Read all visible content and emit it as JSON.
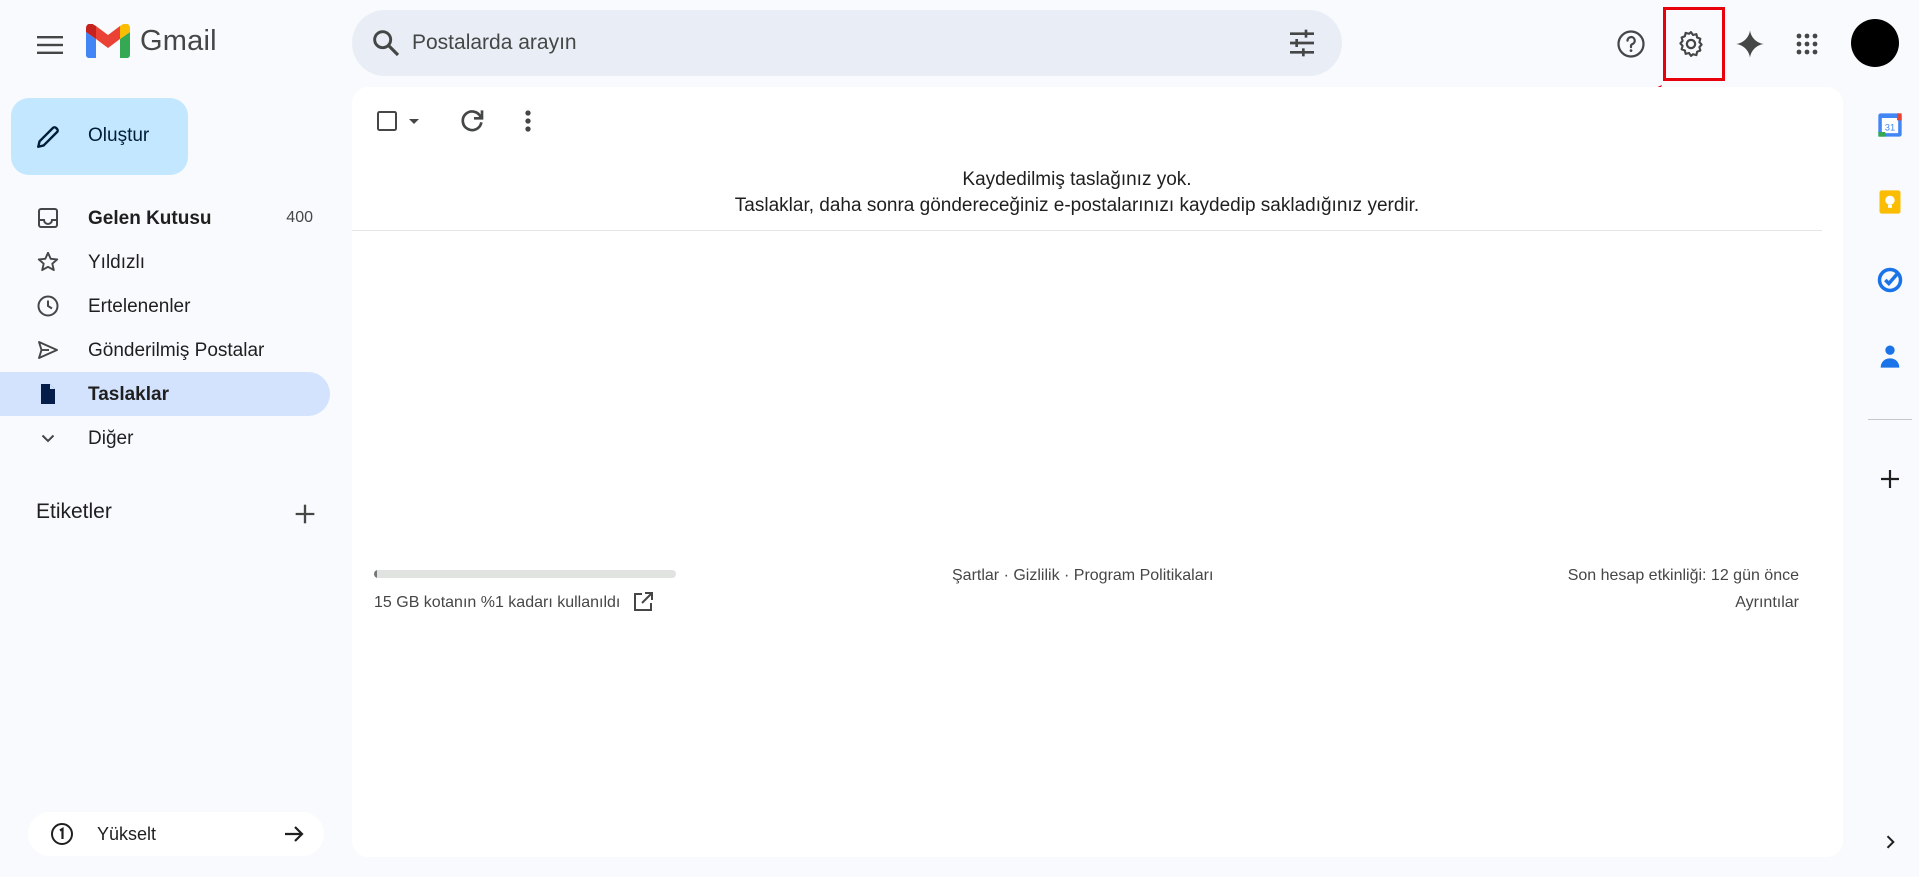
{
  "app": {
    "name": "Gmail"
  },
  "search": {
    "placeholder": "Postalarda arayın"
  },
  "compose": {
    "label": "Oluştur"
  },
  "nav": [
    {
      "label": "Gelen Kutusu",
      "count": "400",
      "icon": "inbox-icon",
      "bold": true
    },
    {
      "label": "Yıldızlı",
      "icon": "star-icon"
    },
    {
      "label": "Ertelenenler",
      "icon": "clock-icon"
    },
    {
      "label": "Gönderilmiş Postalar",
      "icon": "send-icon"
    },
    {
      "label": "Taslaklar",
      "icon": "draft-icon",
      "active": true
    },
    {
      "label": "Diğer",
      "icon": "chevron-down-icon"
    }
  ],
  "labels": {
    "heading": "Etiketler"
  },
  "upgrade": {
    "label": "Yükselt"
  },
  "main": {
    "empty_title": "Kaydedilmiş taslağınız yok.",
    "empty_desc": "Taslaklar, daha sonra göndereceğiniz e-postalarınızı kaydedip sakladığınız yerdir."
  },
  "footer": {
    "storage_text": "15 GB kotanın %1 kadarı kullanıldı",
    "storage_used_fraction": 0.01,
    "links": "Şartlar · Gizlilik · Program Politikaları",
    "activity": "Son hesap etkinliği: 12 gün önce",
    "details": "Ayrıntılar"
  },
  "colors": {
    "accent": "#c2e7ff",
    "active_nav": "#d3e3fd",
    "highlight": "#e8000b"
  }
}
